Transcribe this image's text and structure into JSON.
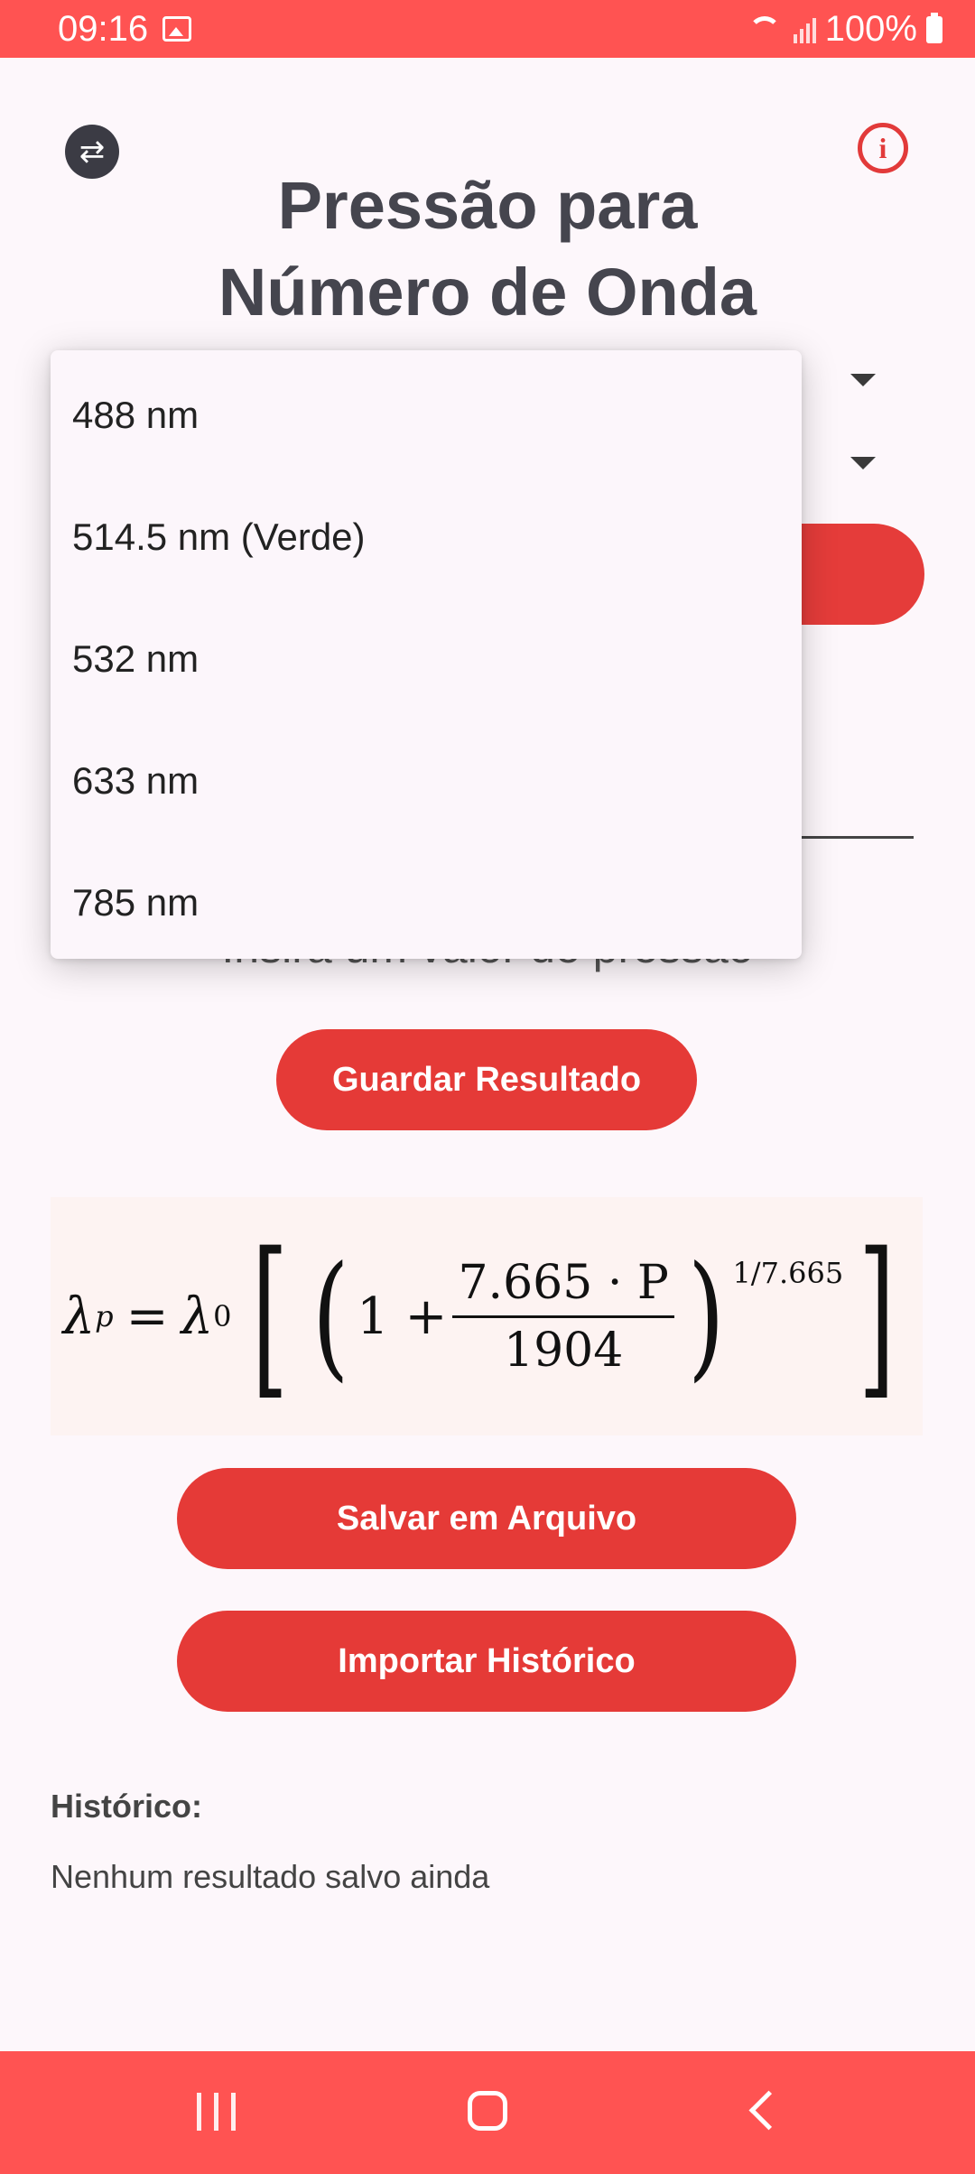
{
  "status_bar": {
    "time": "09:16",
    "battery": "100%"
  },
  "title": {
    "line1": "Pressão para",
    "line2": "Número de Onda"
  },
  "dropdown": {
    "options": [
      "488 nm",
      "514.5 nm (Verde)",
      "532 nm",
      "633 nm",
      "785 nm"
    ]
  },
  "hint": "Insira um valor de pressão",
  "buttons": {
    "save_result": "Guardar Resultado",
    "save_file": "Salvar em Arquivo",
    "import_history": "Importar Histórico"
  },
  "formula": {
    "lhs": "λ",
    "lhs_sub": "p",
    "lambda0": "λ",
    "lambda0_sub": "0",
    "one_plus": "1 +",
    "numerator": "7.665 · P",
    "denominator": "1904",
    "exponent": "1/7.665"
  },
  "history": {
    "label": "Histórico:",
    "empty_text": "Nenhum resultado salvo ainda"
  },
  "icons": {
    "swap": "swap-icon",
    "info": "info-icon"
  },
  "colors": {
    "accent": "#e53a37",
    "status_bar": "#ff5352",
    "background": "#fdf7fb"
  }
}
